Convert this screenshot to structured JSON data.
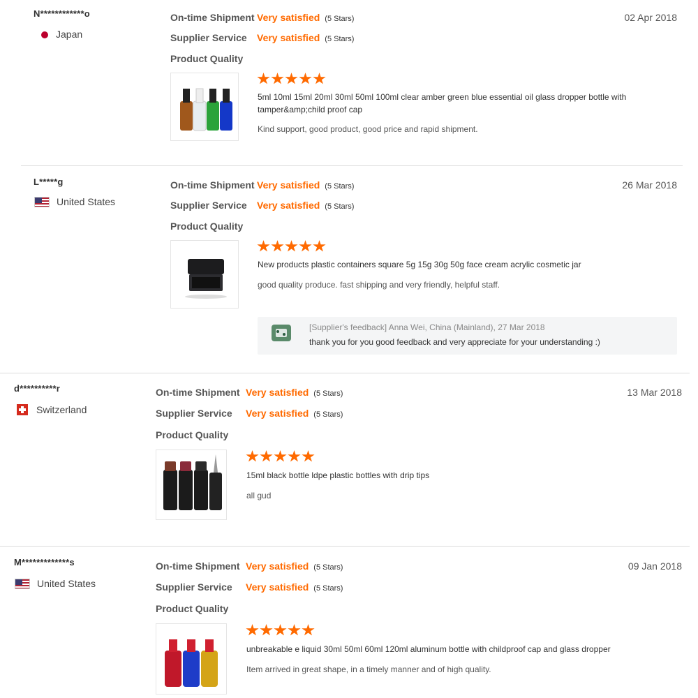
{
  "labels": {
    "on_time": "On-time Shipment",
    "service": "Supplier Service",
    "quality": "Product Quality",
    "very_satisfied": "Very satisfied",
    "five_stars": "(5 Stars)"
  },
  "reviews": [
    {
      "buyer": "N************o",
      "country": "Japan",
      "date": "02 Apr 2018",
      "stars": 5,
      "product_title": "5ml 10ml 15ml 20ml 30ml 50ml 100ml clear amber green blue essential oil glass dropper bottle with tamper&amp;child proof cap",
      "comment": "Kind support, good product, good price and rapid shipment."
    },
    {
      "buyer": "L*****g",
      "country": "United States",
      "date": "26 Mar 2018",
      "stars": 5,
      "product_title": "New products plastic containers square 5g 15g 30g 50g face cream acrylic cosmetic jar",
      "comment": "good quality produce. fast shipping and very friendly, helpful staff.",
      "feedback_meta": "[Supplier's feedback] Anna Wei, China (Mainland), 27 Mar 2018",
      "feedback_text": "thank you for you good feedback and very appreciate for your understanding :)"
    },
    {
      "buyer": "d**********r",
      "country": "Switzerland",
      "date": "13 Mar 2018",
      "stars": 5,
      "product_title": "15ml black bottle ldpe plastic bottles with drip tips",
      "comment": "all gud"
    },
    {
      "buyer": "M*************s",
      "country": "United States",
      "date": "09 Jan 2018",
      "stars": 5,
      "product_title": "unbreakable e liquid 30ml 50ml 60ml 120ml aluminum bottle with childproof cap and glass dropper",
      "comment": "Item arrived in great shape, in a timely manner and of high quality."
    }
  ],
  "colors": {
    "accent": "#ff6a00",
    "divider": "#dddddd",
    "feedback_bg": "#f4f5f6"
  },
  "icons": {
    "star": "star-icon",
    "flag_japan": "flag-japan-icon",
    "flag_us": "flag-us-icon",
    "flag_ch": "flag-switzerland-icon"
  }
}
